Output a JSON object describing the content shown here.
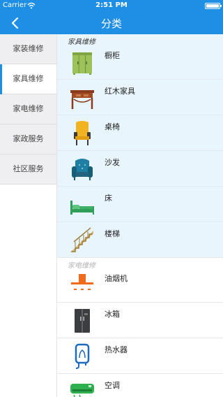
{
  "status_bar": {
    "carrier": "Carrier",
    "time": "2:51 PM",
    "battery_level": 0.9
  },
  "nav": {
    "title": "分类",
    "back_icon": "chevron-left-icon"
  },
  "sidebar": {
    "items": [
      {
        "label": "家装维修",
        "active": false
      },
      {
        "label": "家具维修",
        "active": true
      },
      {
        "label": "家电维修",
        "active": false
      },
      {
        "label": "家政服务",
        "active": false
      },
      {
        "label": "社区服务",
        "active": false
      }
    ]
  },
  "sections": [
    {
      "header": "家具维修",
      "items": [
        {
          "label": "橱柜",
          "icon": "cabinet-icon"
        },
        {
          "label": "红木家具",
          "icon": "rosewood-furniture-icon"
        },
        {
          "label": "桌椅",
          "icon": "chair-icon"
        },
        {
          "label": "沙发",
          "icon": "sofa-icon"
        },
        {
          "label": "床",
          "icon": "bed-icon"
        },
        {
          "label": "楼梯",
          "icon": "stairs-icon"
        }
      ]
    },
    {
      "header": "家电维修",
      "items": [
        {
          "label": "油烟机",
          "icon": "range-hood-icon"
        },
        {
          "label": "冰箱",
          "icon": "refrigerator-icon"
        },
        {
          "label": "热水器",
          "icon": "water-heater-icon"
        },
        {
          "label": "空调",
          "icon": "air-conditioner-icon"
        }
      ]
    }
  ],
  "colors": {
    "accent": "#1f8fe6",
    "sidebar_bg": "#efeff1",
    "section_bg": "#e9f5fd"
  }
}
